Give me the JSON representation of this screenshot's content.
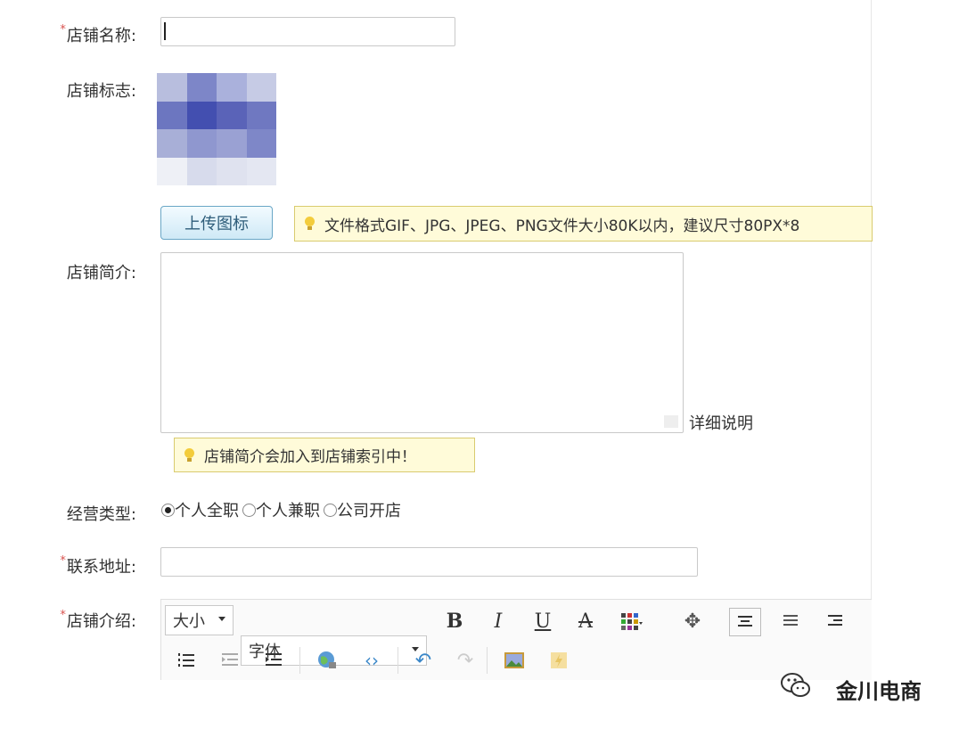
{
  "form": {
    "required_mark": "*",
    "shop_name_label": "店铺名称:",
    "shop_logo_label": "店铺标志:",
    "upload_button": "上传图标",
    "upload_tip": "文件格式GIF、JPG、JPEG、PNG文件大小80K以内，建议尺寸80PX*8",
    "shop_intro_label": "店铺简介:",
    "detail_link": "详细说明",
    "intro_tip": "店铺简介会加入到店铺索引中！",
    "biz_type_label": "经营类型:",
    "biz_types": [
      {
        "label": "个人全职",
        "checked": true
      },
      {
        "label": "个人兼职",
        "checked": false
      },
      {
        "label": "公司开店",
        "checked": false
      }
    ],
    "address_label": "联系地址:",
    "shop_desc_label": "店铺介绍:"
  },
  "editor": {
    "size_select": "大小",
    "font_select": "字体",
    "bold": "B",
    "italic": "I",
    "underline": "U",
    "strike": "A"
  },
  "watermark": {
    "text": "金川电商"
  },
  "colors": {
    "required": "#d9534f",
    "tip_bg": "#fffbd9",
    "button_bg": "#cfe9f6"
  }
}
